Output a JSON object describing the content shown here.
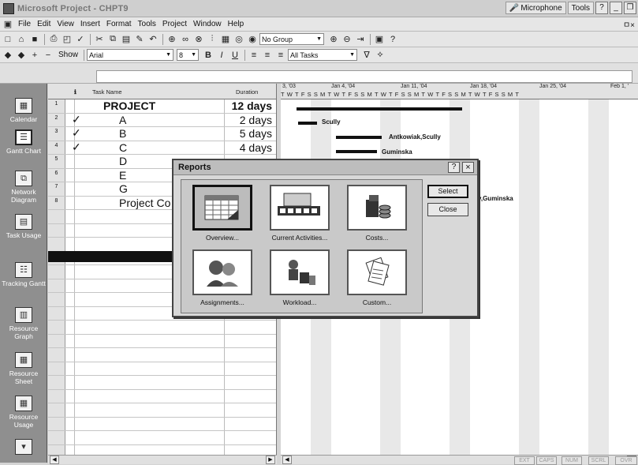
{
  "window": {
    "title": "Microsoft Project - CHPT9",
    "doc_controls": "ㅁ×"
  },
  "langbar": {
    "microphone": "Microphone",
    "tools": "Tools"
  },
  "menu": [
    "File",
    "Edit",
    "View",
    "Insert",
    "Format",
    "Tools",
    "Project",
    "Window",
    "Help"
  ],
  "toolbar": {
    "group_value": "No Group",
    "show_label": "Show",
    "font_value": "Arial",
    "size_value": "8",
    "filter_value": "All Tasks"
  },
  "viewbar": [
    {
      "label": "Calendar",
      "icon": "calendar-icon"
    },
    {
      "label": "Gantt Chart",
      "icon": "gantt-icon"
    },
    {
      "label": "Network Diagram",
      "icon": "network-icon"
    },
    {
      "label": "Task Usage",
      "icon": "task-usage-icon"
    },
    {
      "label": "Tracking Gantt",
      "icon": "tracking-gantt-icon"
    },
    {
      "label": "Resource Graph",
      "icon": "resource-graph-icon"
    },
    {
      "label": "Resource Sheet",
      "icon": "resource-sheet-icon"
    },
    {
      "label": "Resource Usage",
      "icon": "resource-usage-icon"
    }
  ],
  "grid": {
    "headers": {
      "info": "ℹ",
      "task_name": "Task Name",
      "duration": "Duration"
    },
    "rows": [
      {
        "id": "1",
        "done": "",
        "name": "PROJECT",
        "duration": "12 days"
      },
      {
        "id": "2",
        "done": "✓",
        "name": "A",
        "duration": "2 days"
      },
      {
        "id": "3",
        "done": "✓",
        "name": "B",
        "duration": "5 days"
      },
      {
        "id": "4",
        "done": "✓",
        "name": "C",
        "duration": "4 days"
      },
      {
        "id": "5",
        "done": "",
        "name": "D",
        "duration": ""
      },
      {
        "id": "6",
        "done": "",
        "name": "E",
        "duration": ""
      },
      {
        "id": "7",
        "done": "",
        "name": "G",
        "duration": ""
      },
      {
        "id": "8",
        "done": "",
        "name": "Project Co",
        "duration": ""
      }
    ]
  },
  "gantt": {
    "weeks": [
      "3, '03",
      "Jan 4, '04",
      "Jan 11, '04",
      "Jan 18, '04",
      "Jan 25, '04",
      "Feb 1, '"
    ],
    "days": "TWTFSSMTWTFSSMTWTFSSMTWTFSSMTWTFSSMT",
    "labels": {
      "scully": "Scully",
      "antkowiak": "Antkowiak,Scully",
      "guminska": "Guminska",
      "ry_guminska": "y,Guminska"
    }
  },
  "dialog": {
    "title": "Reports",
    "help": "?",
    "close_x": "×",
    "reports": [
      {
        "label": "Overview...",
        "icon": "overview-report-icon"
      },
      {
        "label": "Current Activities...",
        "icon": "current-activities-icon"
      },
      {
        "label": "Costs...",
        "icon": "costs-icon"
      },
      {
        "label": "Assignments...",
        "icon": "assignments-icon"
      },
      {
        "label": "Workload...",
        "icon": "workload-icon"
      },
      {
        "label": "Custom...",
        "icon": "custom-report-icon"
      }
    ],
    "select_label": "Select",
    "close_label": "Close"
  },
  "status": [
    "EXT",
    "CAPS",
    "NUM",
    "SCRL",
    "OVR"
  ]
}
